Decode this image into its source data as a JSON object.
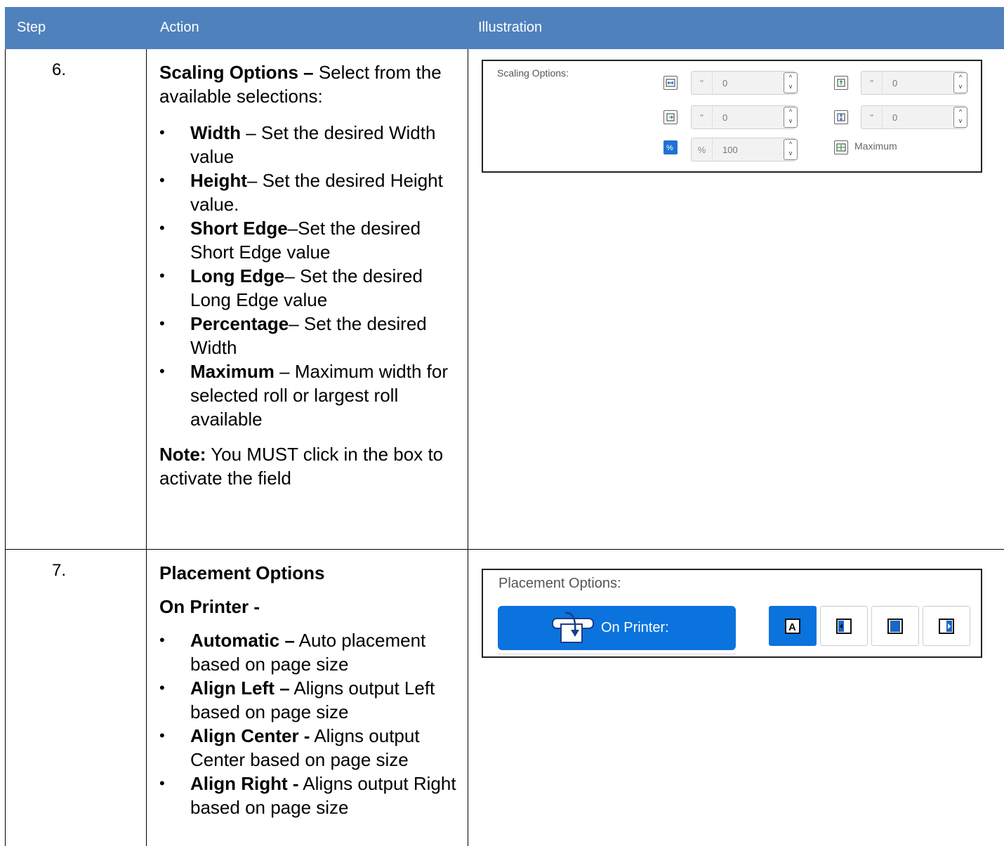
{
  "table": {
    "headers": {
      "step": "Step",
      "action": "Action",
      "illustration": "Illustration"
    },
    "rows": [
      {
        "step": "6.",
        "title": "Scaling Options –",
        "title_rest": " Select from the available selections:",
        "bullets": [
          {
            "bold": "Width",
            "text": " – Set the desired Width value"
          },
          {
            "bold": "Height",
            "text": "– Set the desired Height value."
          },
          {
            "bold": "Short Edge",
            "text": "–Set the desired Short Edge value"
          },
          {
            "bold": "Long Edge",
            "text": "– Set the desired Long Edge value"
          },
          {
            "bold": "Percentage",
            "text": "– Set the desired Width"
          },
          {
            "bold": "Maximum",
            "text": " – Maximum width for selected roll or largest roll available"
          }
        ],
        "note_bold": "Note:",
        "note_text": " You MUST click in the box to activate the field"
      },
      {
        "step": "7.",
        "title": "Placement Options",
        "subtitle": "On Printer -",
        "bullets": [
          {
            "bold": "Automatic –",
            "text": " Auto placement based on page size"
          },
          {
            "bold": "Align Left –",
            "text": " Aligns output Left based on page size"
          },
          {
            "bold": "Align Center -",
            "text": " Aligns output Center based on page size"
          },
          {
            "bold": "Align Right -",
            "text": " Aligns output Right based on page size"
          }
        ]
      }
    ]
  },
  "scaling_panel": {
    "label": "Scaling Options:",
    "fields": [
      {
        "icon": "width-icon",
        "unit": "\"",
        "value": "0",
        "selected": false
      },
      {
        "icon": "short-edge-icon",
        "unit": "\"",
        "value": "0",
        "selected": false
      },
      {
        "icon": "height-icon",
        "unit": "\"",
        "value": "0",
        "selected": false
      },
      {
        "icon": "long-edge-icon",
        "unit": "\"",
        "value": "0",
        "selected": false
      },
      {
        "icon": "percentage-icon",
        "unit": "%",
        "value": "100",
        "selected": true
      }
    ],
    "maximum_label": "Maximum",
    "spin_up": "^",
    "spin_down": "v"
  },
  "placement_panel": {
    "label": "Placement Options:",
    "on_printer_label": "On Printer:",
    "align_buttons": [
      {
        "name": "automatic",
        "icon": "align-automatic-icon",
        "selected": true
      },
      {
        "name": "align-left",
        "icon": "align-left-icon",
        "selected": false
      },
      {
        "name": "align-center",
        "icon": "align-center-icon",
        "selected": false
      },
      {
        "name": "align-right",
        "icon": "align-right-icon",
        "selected": false
      }
    ]
  },
  "colors": {
    "header_bg": "#4f81bd",
    "accent": "#0b73dd"
  }
}
